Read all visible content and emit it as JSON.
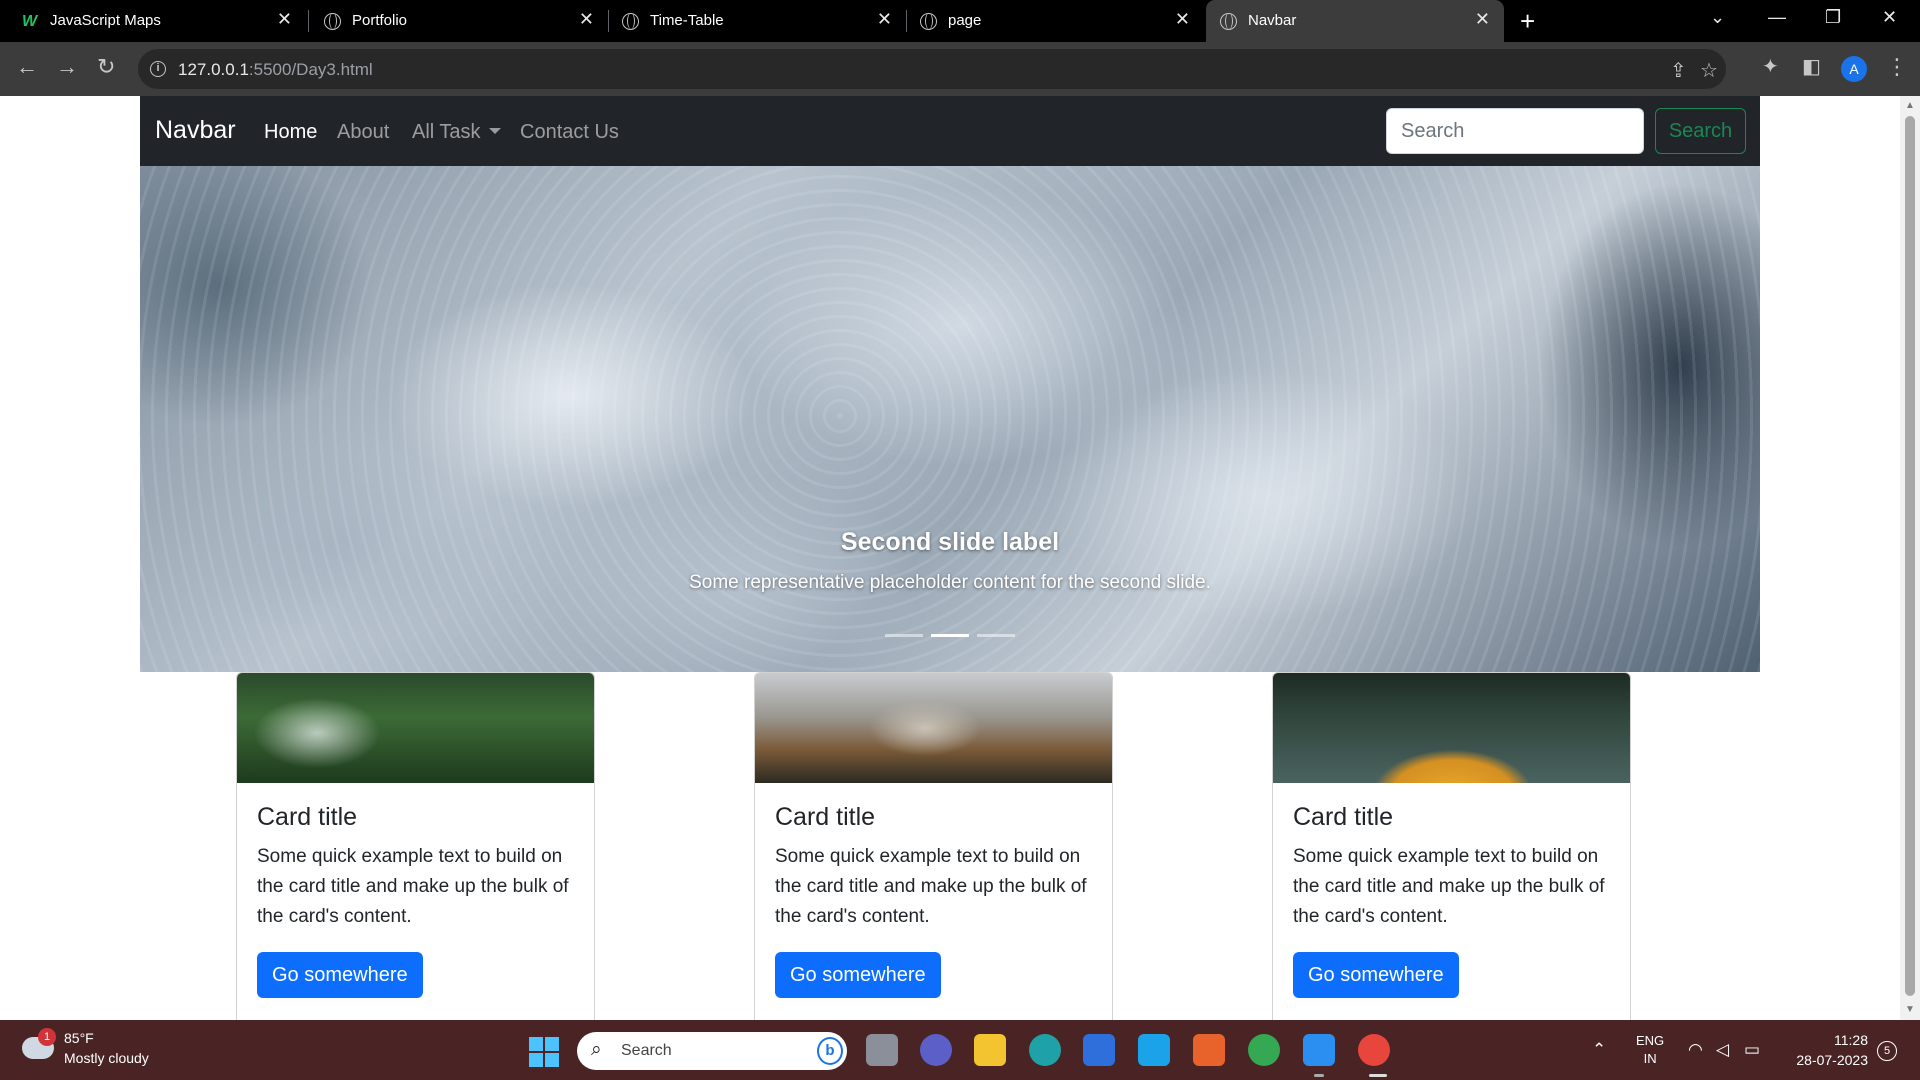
{
  "browser": {
    "tabs": [
      {
        "title": "JavaScript Maps",
        "favicon": "w-logo-icon",
        "active": false
      },
      {
        "title": "Portfolio",
        "favicon": "globe-icon",
        "active": false
      },
      {
        "title": "Time-Table",
        "favicon": "globe-icon",
        "active": false
      },
      {
        "title": "page",
        "favicon": "globe-icon",
        "active": false
      },
      {
        "title": "Navbar",
        "favicon": "globe-icon",
        "active": true
      }
    ],
    "close_glyph": "✕",
    "new_tab_glyph": "+",
    "url_host": "127.0.0.1",
    "url_rest": ":5500/Day3.html",
    "profile_initial": "A"
  },
  "page": {
    "navbar": {
      "brand": "Navbar",
      "links": [
        "Home",
        "About",
        "All Task",
        "Contact Us"
      ],
      "search_placeholder": "Search",
      "search_button": "Search"
    },
    "carousel": {
      "caption_title": "Second slide label",
      "caption_text": "Some representative placeholder content for the second slide.",
      "slide_count": 3,
      "active_slide": 2
    },
    "cards": [
      {
        "image": "forest",
        "title": "Card title",
        "text": "Some quick example text to build on the card title and make up the bulk of the card's content.",
        "button": "Go somewhere"
      },
      {
        "image": "mountain-valley",
        "title": "Card title",
        "text": "Some quick example text to build on the card title and make up the bulk of the card's content.",
        "button": "Go somewhere"
      },
      {
        "image": "kayak-on-lake",
        "title": "Card title",
        "text": "Some quick example text to build on the card title and make up the bulk of the card's content.",
        "button": "Go somewhere"
      }
    ]
  },
  "taskbar": {
    "weather_badge": "1",
    "weather_temp": "85°F",
    "weather_desc": "Mostly cloudy",
    "search_text": "Search",
    "lang_line1": "ENG",
    "lang_line2": "IN",
    "time": "11:28",
    "date": "28-07-2023",
    "notification_count": "5"
  },
  "colors": {
    "primary": "#0d6efd",
    "success": "#198754",
    "navbar_bg": "#212529",
    "taskbar_bg": "#4a2424"
  }
}
